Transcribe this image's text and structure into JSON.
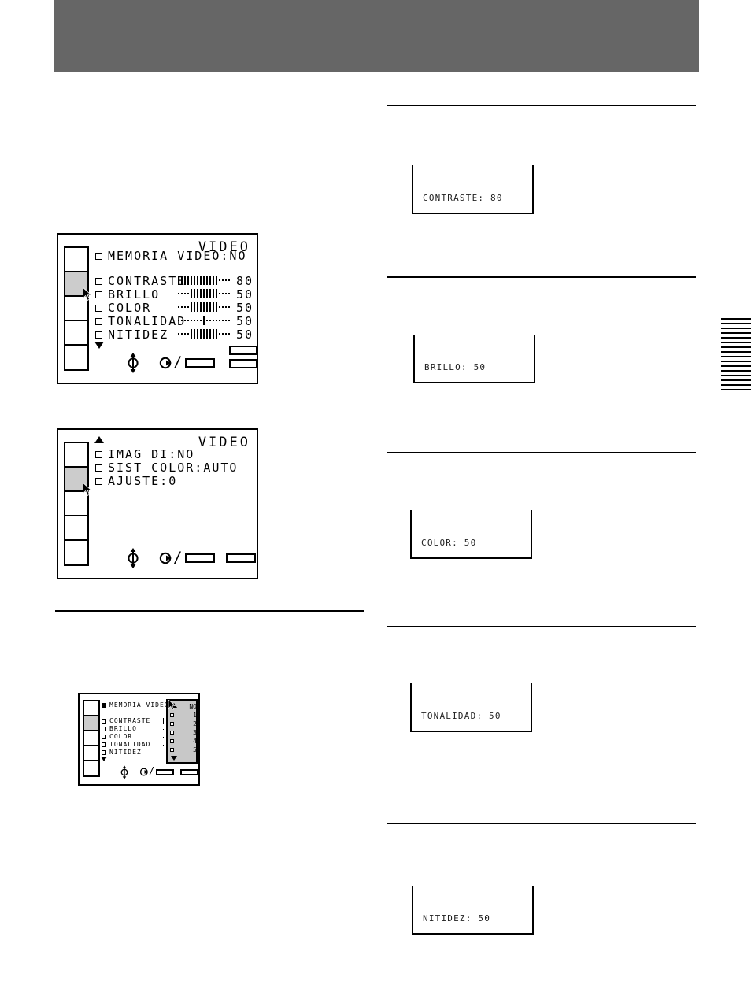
{
  "page": {
    "header_band_color": "#666666",
    "ink_color": "#000000",
    "highlight_color": "#cccccc",
    "dropdown_bg": "#c8c8c8"
  },
  "osd_menu_1": {
    "title": "VIDEO",
    "rows": [
      {
        "checkbox": "empty",
        "label": "MEMORIA VIDEO:NO",
        "bar": null,
        "value": null
      },
      {
        "checkbox": "empty",
        "label": "CONTRASTE",
        "bar": {
          "filled": 13,
          "dotted": 4
        },
        "value": "80"
      },
      {
        "checkbox": "empty",
        "label": "BRILLO",
        "bar": {
          "filled": 9,
          "dotted": 8
        },
        "value": "50"
      },
      {
        "checkbox": "empty",
        "label": "COLOR",
        "bar": {
          "filled": 9,
          "dotted": 8
        },
        "value": "50"
      },
      {
        "checkbox": "empty",
        "label": "TONALIDAD",
        "bar": {
          "filled": 1,
          "dotted": 16
        },
        "value": "50"
      },
      {
        "checkbox": "empty",
        "label": "NITIDEZ",
        "bar": {
          "filled": 9,
          "dotted": 8
        },
        "value": "50"
      }
    ],
    "scroll_down_marker": "▼",
    "rail_cells": 5,
    "rail_selected_index": 1,
    "footer_icons": [
      "updown-circle-icon",
      "enter-circle-icon",
      "slash-icon",
      "button-bar-icon",
      "button-bar-icon",
      "button-bar-icon"
    ]
  },
  "osd_menu_2": {
    "title": "VIDEO",
    "scroll_up_marker": "▲",
    "rows": [
      {
        "checkbox": "empty",
        "label": "IMAG DI:NO"
      },
      {
        "checkbox": "empty",
        "label": "SIST COLOR:AUTO"
      },
      {
        "checkbox": "empty",
        "label": "AJUSTE:0"
      }
    ],
    "rail_cells": 5,
    "rail_selected_index": 1,
    "footer_icons": [
      "updown-circle-icon",
      "enter-circle-icon",
      "slash-icon",
      "button-bar-icon",
      "button-bar-icon"
    ]
  },
  "osd_menu_3": {
    "rows": [
      {
        "checkbox": "filled",
        "label": "MEMORIA VIDEO",
        "caret": "◄"
      },
      {
        "checkbox": "empty",
        "label": "CONTRASTE",
        "bar": {
          "filled": 11,
          "dotted": 3
        }
      },
      {
        "checkbox": "empty",
        "label": "BRILLO",
        "bar": {
          "filled": 8,
          "dotted": 6
        }
      },
      {
        "checkbox": "empty",
        "label": "COLOR",
        "bar": {
          "filled": 8,
          "dotted": 6
        }
      },
      {
        "checkbox": "empty",
        "label": "TONALIDAD",
        "bar": {
          "filled": 1,
          "dotted": 13
        }
      },
      {
        "checkbox": "empty",
        "label": "NITIDEZ",
        "bar": {
          "filled": 8,
          "dotted": 6
        }
      }
    ],
    "scroll_down_marker": "▼",
    "rail_cells": 5,
    "rail_selected_index": 1,
    "dropdown": {
      "scroll_up_marker": "▲",
      "scroll_down_marker": "▼",
      "options": [
        "NO",
        "1",
        "2",
        "3",
        "4",
        "5"
      ],
      "selected": "NO"
    },
    "footer_icons": [
      "updown-circle-icon",
      "enter-circle-icon",
      "slash-icon",
      "button-bar-icon",
      "button-bar-icon"
    ]
  },
  "callouts": [
    {
      "name": "contraste",
      "text": "CONTRASTE: 80"
    },
    {
      "name": "brillo",
      "text": "BRILLO: 50"
    },
    {
      "name": "color",
      "text": "COLOR: 50"
    },
    {
      "name": "tonalidad",
      "text": "TONALIDAD: 50"
    },
    {
      "name": "nitidez",
      "text": "NITIDEZ: 50"
    }
  ]
}
